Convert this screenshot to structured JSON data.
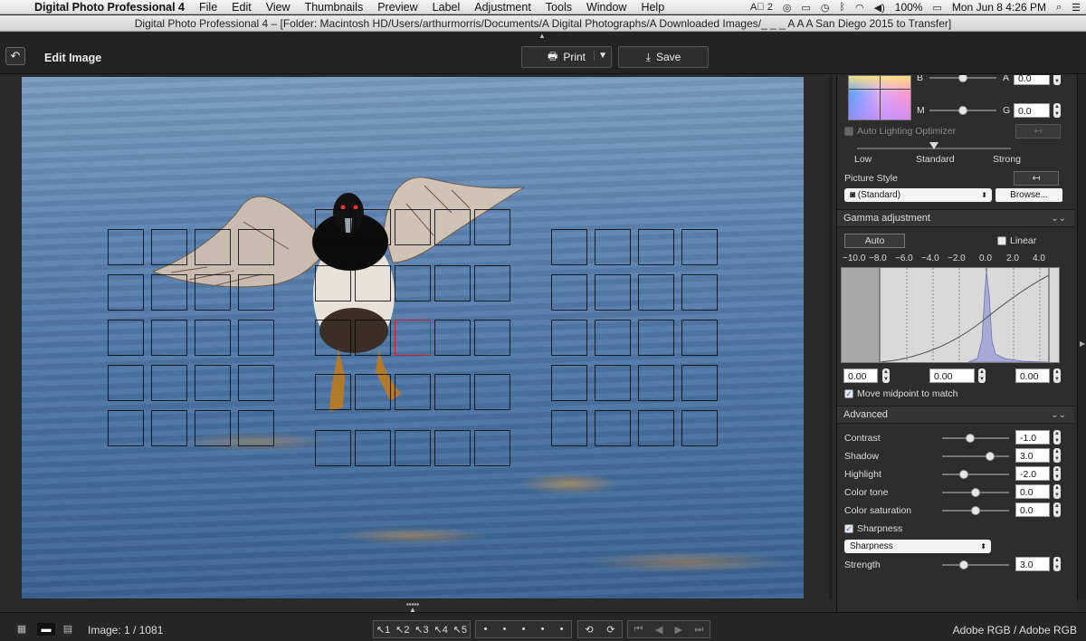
{
  "menubar": {
    "app_name": "Digital Photo Professional 4",
    "items": [
      "File",
      "Edit",
      "View",
      "Thumbnails",
      "Preview",
      "Label",
      "Adjustment",
      "Tools",
      "Window",
      "Help"
    ],
    "adobe_badge": "2",
    "battery": "100%",
    "clock": "Mon Jun 8  4:26 PM"
  },
  "window": {
    "title": "Digital Photo Professional 4 – [Folder: Macintosh HD/Users/arthurmorris/Documents/A Digital Photographs/A Downloaded Images/_ _ _ A A A San Diego 2015 to Transfer]"
  },
  "toolbar": {
    "title": "Edit Image",
    "print_label": "Print",
    "save_label": "Save"
  },
  "panel": {
    "color_b_label": "B",
    "color_a_label": "A",
    "color_a_value": "0.0",
    "color_m_label": "M",
    "color_g_label": "G",
    "color_g_value": "0.0",
    "alo_label": "Auto Lighting Optimizer",
    "alo_low": "Low",
    "alo_standard": "Standard",
    "alo_strong": "Strong",
    "picture_style_label": "Picture Style",
    "picture_style_value": "(Standard)",
    "browse_label": "Browse...",
    "gamma_header": "Gamma adjustment",
    "auto_label": "Auto",
    "linear_label": "Linear",
    "gamma_ticks": [
      "−10.0",
      "−8.0",
      "−6.0",
      "−4.0",
      "−2.0",
      "0.0",
      "2.0",
      "4.0"
    ],
    "gamma_low": "0.00",
    "gamma_mid": "0.00",
    "gamma_high": "0.00",
    "midpoint_label": "Move midpoint to match",
    "advanced_header": "Advanced",
    "contrast_label": "Contrast",
    "contrast_value": "-1.0",
    "contrast_level": 0.4,
    "shadow_label": "Shadow",
    "shadow_value": "3.0",
    "shadow_level": 0.75,
    "highlight_label": "Highlight",
    "highlight_value": "-2.0",
    "highlight_level": 0.3,
    "color_tone_label": "Color tone",
    "color_tone_value": "0.0",
    "color_tone_level": 0.5,
    "color_sat_label": "Color saturation",
    "color_sat_value": "0.0",
    "color_sat_level": 0.5,
    "sharpness_check_label": "Sharpness",
    "sharpness_mode": "Sharpness",
    "strength_label": "Strength",
    "strength_value": "3.0",
    "strength_level": 0.3
  },
  "bottombar": {
    "image_counter": "Image: 1 / 1081",
    "ratings": [
      "1",
      "2",
      "3",
      "4",
      "5"
    ],
    "color_space": "Adobe RGB / Adobe RGB"
  },
  "colors": {
    "af_active": "#d12222",
    "panel_bg": "#2d2d2d",
    "toolbar_bg": "#232323"
  }
}
